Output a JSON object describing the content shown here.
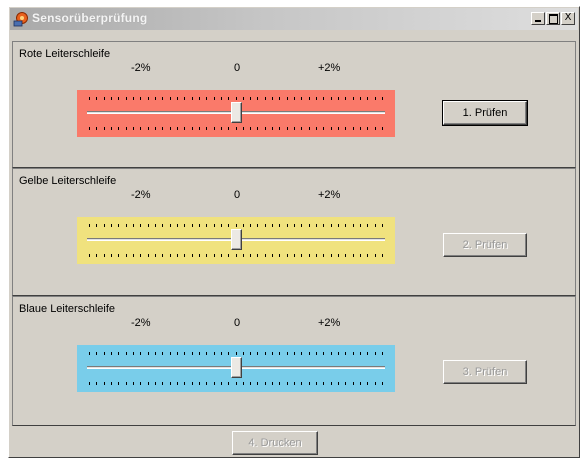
{
  "window": {
    "title": "Sensorüberprüfung",
    "minimize_glyph": "_",
    "maximize_glyph": "□",
    "close_glyph": "X"
  },
  "scale": {
    "neg": "-2%",
    "zero": "0",
    "pos": "+2%"
  },
  "loops": [
    {
      "title": "Rote Leiterschleife",
      "button": "1. Prüfen",
      "color": "#fa7a6a",
      "value": 0.5,
      "enabled": true
    },
    {
      "title": "Gelbe Leiterschleife",
      "button": "2. Prüfen",
      "color": "#f0e27e",
      "value": 0.5,
      "enabled": false
    },
    {
      "title": "Blaue Leiterschleife",
      "button": "3. Prüfen",
      "color": "#79cdea",
      "value": 0.5,
      "enabled": false
    }
  ],
  "print_button": "4. Drucken"
}
